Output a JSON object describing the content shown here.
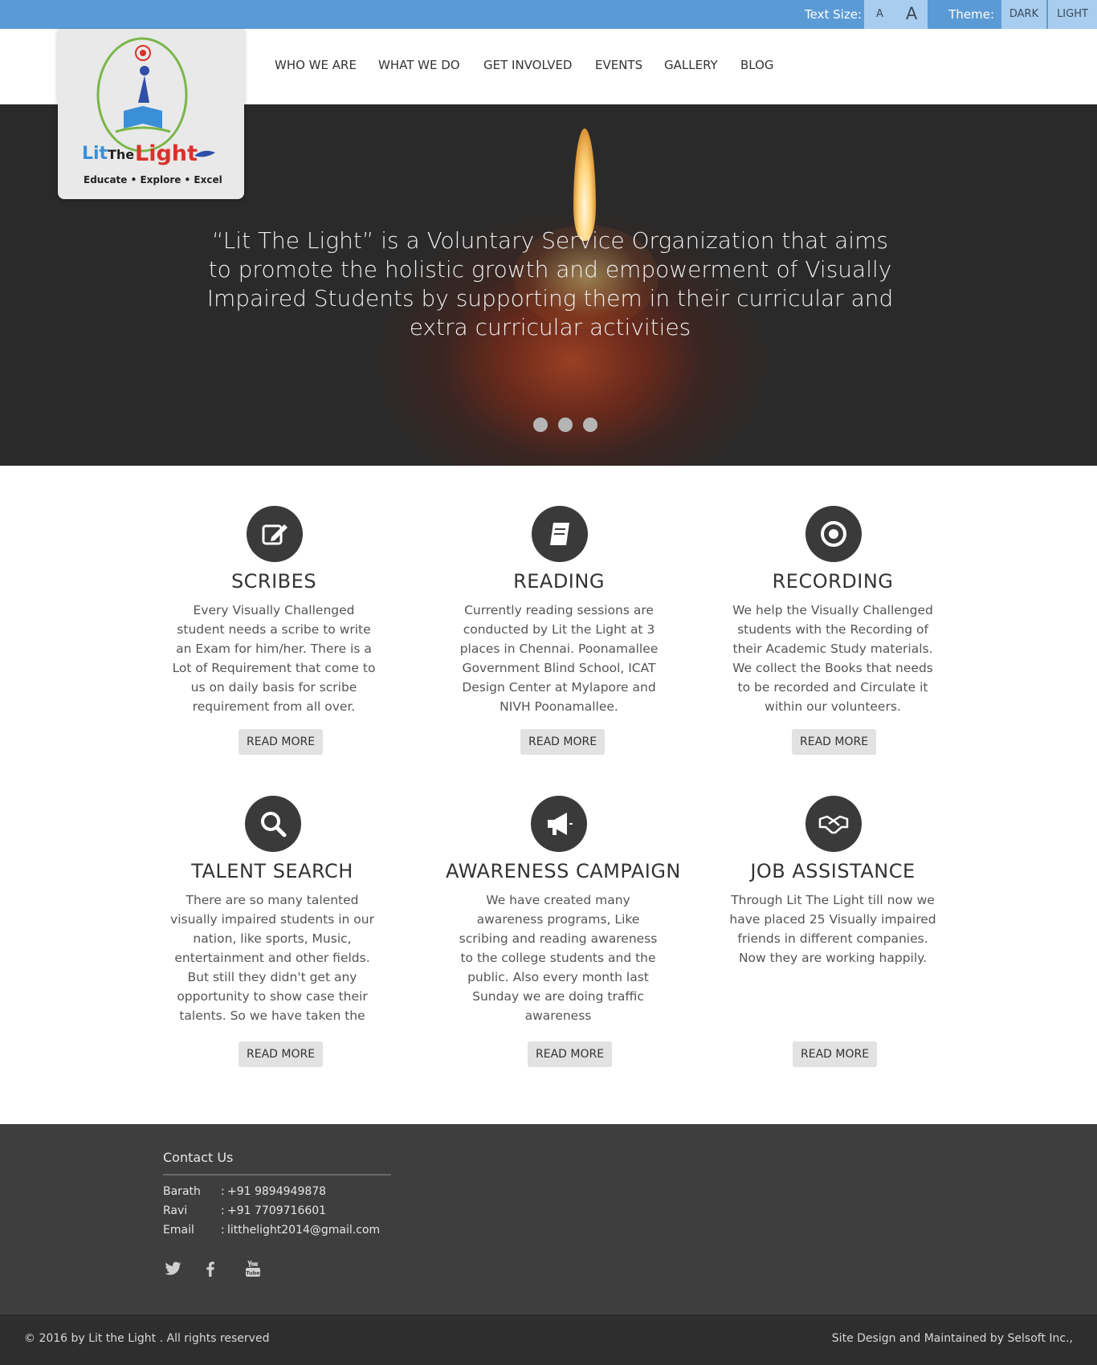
{
  "topbar": {
    "text_size_label": "Text Size:",
    "text_size_small": "A",
    "text_size_large": "A",
    "theme_label": "Theme:",
    "theme_dark": "DARK",
    "theme_light": "LIGHT"
  },
  "logo": {
    "word1": "Lit",
    "word2": "The",
    "word3": "Light",
    "tagline": "Educate • Explore • Excel"
  },
  "nav": {
    "items": [
      "WHO WE ARE",
      "WHAT WE DO",
      "GET INVOLVED",
      "EVENTS",
      "GALLERY",
      "BLOG"
    ]
  },
  "hero": {
    "tagline": "“Lit The Light” is a Voluntary Service Organization that aims to promote the holistic growth and empowerment of Visually Impaired Students by supporting them in their curricular and extra curricular activities",
    "slides": 3
  },
  "features": [
    {
      "icon": "edit-icon",
      "title": "SCRIBES",
      "text": "Every Visually Challenged student needs a scribe to write an Exam for him/her. There is a Lot of Requirement that come to us on daily basis for scribe requirement from all over.",
      "button": "READ MORE"
    },
    {
      "icon": "book-icon",
      "title": "READING",
      "text": "Currently reading sessions are conducted by Lit the Light at 3 places in Chennai. Poonamallee Government Blind School, ICAT Design Center at Mylapore and NIVH Poonamallee.",
      "button": "READ MORE"
    },
    {
      "icon": "record-icon",
      "title": "RECORDING",
      "text": "We help the Visually Challenged students with the Recording of their Academic Study materials. We collect the Books that needs to be recorded and Circulate it within our volunteers.",
      "button": "READ MORE"
    },
    {
      "icon": "search-icon",
      "title": "TALENT SEARCH",
      "text": "There are so many talented visually impaired students in our nation, like sports, Music, entertainment and other fields. But still they didn't get any opportunity to show case their talents. So we have taken the",
      "button": "READ MORE"
    },
    {
      "icon": "megaphone-icon",
      "title": "AWARENESS  CAMPAIGN",
      "text": "We have created many awareness programs, Like scribing and reading awareness to the college students and the public. Also every month last Sunday we are doing traffic awareness",
      "button": "READ MORE"
    },
    {
      "icon": "handshake-icon",
      "title": "JOB ASSISTANCE",
      "text": "Through Lit The Light till now we have placed 25 Visually impaired friends in different companies. Now they are working happily.",
      "button": "READ MORE"
    }
  ],
  "footer": {
    "contact_title": "Contact Us",
    "contacts": [
      {
        "name": "Barath",
        "sep": ":",
        "value": "+91 9894949878"
      },
      {
        "name": "Ravi",
        "sep": ":",
        "value": "+91 7709716601"
      },
      {
        "name": "Email",
        "sep": ":",
        "value": "litthelight2014@gmail.com"
      }
    ],
    "social": [
      "twitter-icon",
      "facebook-icon",
      "youtube-icon"
    ],
    "copyright": "© 2016 by Lit the Light . All rights reserved",
    "credit": "Site Design and Maintained by Selsoft Inc.,"
  }
}
